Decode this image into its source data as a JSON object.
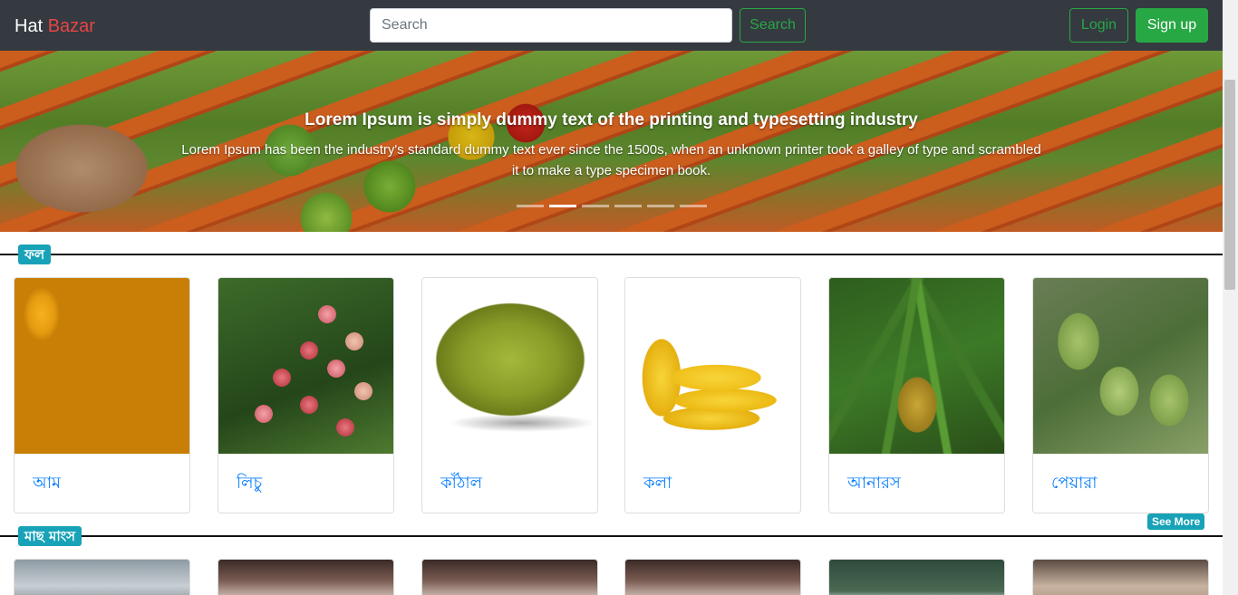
{
  "navbar": {
    "brand_part1": "Hat",
    "brand_part2": "Bazar",
    "search_placeholder": "Search",
    "search_button": "Search",
    "login": "Login",
    "signup": "Sign up"
  },
  "carousel": {
    "title": "Lorem Ipsum is simply dummy text of the printing and typesetting industry",
    "text": "Lorem Ipsum has been the industry's standard dummy text ever since the 1500s, when an unknown printer took a galley of type and scrambled it to make a type specimen book.",
    "slide_count": 6,
    "active_slide": 2
  },
  "sections": [
    {
      "label": "ফল",
      "items": [
        "আম",
        "লিচু",
        "কাঁঠাল",
        "কলা",
        "আনারস",
        "পেয়ারা"
      ],
      "see_more": "See More"
    },
    {
      "label": "মাছ মাংস"
    }
  ],
  "colors": {
    "navbar_bg": "#343a40",
    "brand_accent": "#e84545",
    "success": "#28a745",
    "badge": "#17a2b8",
    "link": "#007bff"
  }
}
